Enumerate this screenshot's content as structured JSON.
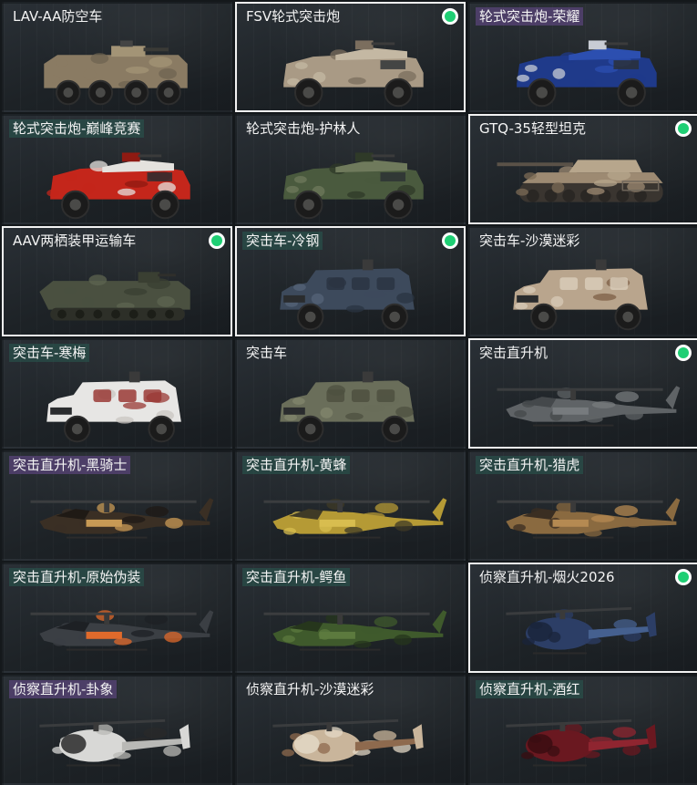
{
  "colors": {
    "background": "#14181b",
    "selected_border": "#f2f2f2",
    "equipped_dot": "#1fcf74"
  },
  "vehicles": [
    {
      "name": "LAV-AA防空车",
      "kind": "apc8",
      "camo": [
        "#8a7b63",
        "#6e6350",
        "#a39476"
      ],
      "selected": false,
      "equipped": false,
      "tint": "none"
    },
    {
      "name": "FSV轮式突击炮",
      "kind": "armored4",
      "camo": [
        "#a99a85",
        "#c4b8a3",
        "#7b6e5e"
      ],
      "selected": true,
      "equipped": true,
      "tint": "none"
    },
    {
      "name": "轮式突击炮-荣耀",
      "kind": "armored4",
      "camo": [
        "#1f3a8a",
        "#2c4fb0",
        "#c8ccd4"
      ],
      "selected": false,
      "equipped": false,
      "tint": "purple"
    },
    {
      "name": "轮式突击炮-巅峰竞赛",
      "kind": "armored4",
      "camo": [
        "#c4261b",
        "#e4e2de",
        "#8f1a12"
      ],
      "selected": false,
      "equipped": false,
      "tint": "teal"
    },
    {
      "name": "轮式突击炮-护林人",
      "kind": "armored4",
      "camo": [
        "#4a5a3e",
        "#6f7a5c",
        "#2f3a28"
      ],
      "selected": false,
      "equipped": false,
      "tint": "none"
    },
    {
      "name": "GTQ-35轻型坦克",
      "kind": "tank",
      "camo": [
        "#9d8a72",
        "#b7a68c",
        "#7c6b56"
      ],
      "selected": true,
      "equipped": true,
      "tint": "none"
    },
    {
      "name": "AAV两栖装甲运输车",
      "kind": "aav",
      "camo": [
        "#4a5040",
        "#5e6450",
        "#3a3f32"
      ],
      "selected": true,
      "equipped": true,
      "tint": "none"
    },
    {
      "name": "突击车-冷钢",
      "kind": "mrap",
      "camo": [
        "#3d4a5c",
        "#566478",
        "#2a3442"
      ],
      "selected": true,
      "equipped": true,
      "tint": "teal"
    },
    {
      "name": "突击车-沙漠迷彩",
      "kind": "mrap",
      "camo": [
        "#b9a58d",
        "#7d5f46",
        "#d8cbb8"
      ],
      "selected": false,
      "equipped": false,
      "tint": "none"
    },
    {
      "name": "突击车-寒梅",
      "kind": "mrap",
      "camo": [
        "#e7e6e4",
        "#c9c6c2",
        "#9a3a36"
      ],
      "selected": false,
      "equipped": false,
      "tint": "teal"
    },
    {
      "name": "突击车",
      "kind": "mrap",
      "camo": [
        "#6a6e5a",
        "#83876e",
        "#4d5040"
      ],
      "selected": false,
      "equipped": false,
      "tint": "none"
    },
    {
      "name": "突击直升机",
      "kind": "heli",
      "camo": [
        "#5f6366",
        "#777b7e",
        "#44484b"
      ],
      "selected": true,
      "equipped": true,
      "tint": "none"
    },
    {
      "name": "突击直升机-黑骑士",
      "kind": "heli",
      "camo": [
        "#3a2f24",
        "#c89a55",
        "#1f1a15"
      ],
      "selected": false,
      "equipped": false,
      "tint": "purple"
    },
    {
      "name": "突击直升机-黄蜂",
      "kind": "heli",
      "camo": [
        "#b59a35",
        "#d8bd4f",
        "#3f3a26"
      ],
      "selected": false,
      "equipped": false,
      "tint": "teal"
    },
    {
      "name": "突击直升机-猎虎",
      "kind": "heli",
      "camo": [
        "#8a6a40",
        "#b58a52",
        "#3a2e22"
      ],
      "selected": false,
      "equipped": false,
      "tint": "teal"
    },
    {
      "name": "突击直升机-原始伪装",
      "kind": "heli",
      "camo": [
        "#3b3f44",
        "#e06a2b",
        "#1d2024"
      ],
      "selected": false,
      "equipped": false,
      "tint": "teal"
    },
    {
      "name": "突击直升机-鳄鱼",
      "kind": "heli",
      "camo": [
        "#3f5a2c",
        "#5c7a3e",
        "#26361c"
      ],
      "selected": false,
      "equipped": false,
      "tint": "teal"
    },
    {
      "name": "侦察直升机-烟火2026",
      "kind": "scout",
      "camo": [
        "#2c3e66",
        "#45608f",
        "#1a243b"
      ],
      "selected": true,
      "equipped": true,
      "tint": "none"
    },
    {
      "name": "侦察直升机-卦象",
      "kind": "scout",
      "camo": [
        "#d8d8d6",
        "#b9b9b6",
        "#2a2a2a"
      ],
      "selected": false,
      "equipped": false,
      "tint": "purple"
    },
    {
      "name": "侦察直升机-沙漠迷彩",
      "kind": "scout",
      "camo": [
        "#c9b59b",
        "#8e6a4e",
        "#e3d8c6"
      ],
      "selected": false,
      "equipped": false,
      "tint": "none"
    },
    {
      "name": "侦察直升机-酒红",
      "kind": "scout",
      "camo": [
        "#6a1820",
        "#8f2530",
        "#3a0d12"
      ],
      "selected": false,
      "equipped": false,
      "tint": "teal"
    }
  ]
}
